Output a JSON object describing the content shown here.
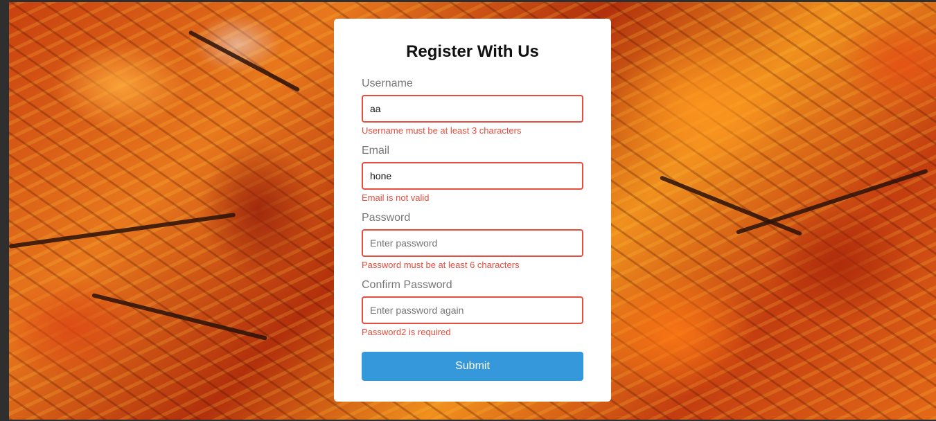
{
  "form": {
    "title": "Register With Us",
    "fields": [
      {
        "label": "Username",
        "value": "aa",
        "placeholder": "",
        "error": "Username must be at least 3 characters"
      },
      {
        "label": "Email",
        "value": "hone",
        "placeholder": "",
        "error": "Email is not valid"
      },
      {
        "label": "Password",
        "value": "",
        "placeholder": "Enter password",
        "error": "Password must be at least 6 characters"
      },
      {
        "label": "Confirm Password",
        "value": "",
        "placeholder": "Enter password again",
        "error": "Password2 is required"
      }
    ],
    "submit_label": "Submit"
  },
  "colors": {
    "error": "#e74c3c",
    "button": "#3498db",
    "card": "#ffffff"
  }
}
